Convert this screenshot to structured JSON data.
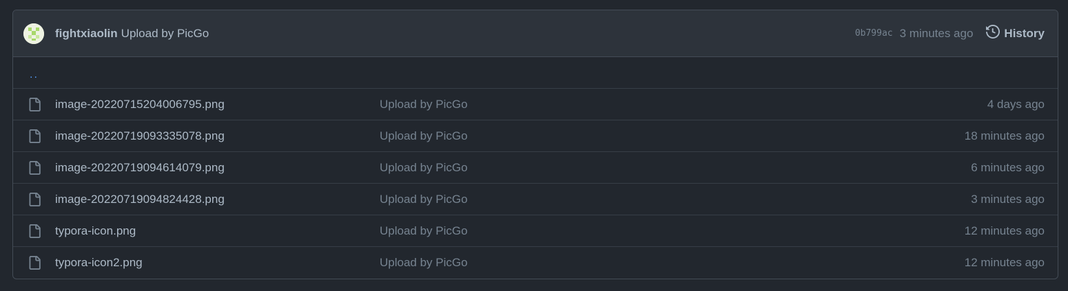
{
  "commit": {
    "author": "fightxiaolin",
    "message": "Upload by PicGo",
    "sha": "0b799ac",
    "time": "3 minutes ago",
    "history_label": "History"
  },
  "parent_dir": "..",
  "files": [
    {
      "name": "image-20220715204006795.png",
      "message": "Upload by PicGo",
      "age": "4 days ago",
      "icon": "file-icon"
    },
    {
      "name": "image-20220719093335078.png",
      "message": "Upload by PicGo",
      "age": "18 minutes ago",
      "icon": "file-icon"
    },
    {
      "name": "image-20220719094614079.png",
      "message": "Upload by PicGo",
      "age": "6 minutes ago",
      "icon": "file-icon"
    },
    {
      "name": "image-20220719094824428.png",
      "message": "Upload by PicGo",
      "age": "3 minutes ago",
      "icon": "file-icon"
    },
    {
      "name": "typora-icon.png",
      "message": "Upload by PicGo",
      "age": "12 minutes ago",
      "icon": "file-icon"
    },
    {
      "name": "typora-icon2.png",
      "message": "Upload by PicGo",
      "age": "12 minutes ago",
      "icon": "file-icon"
    }
  ],
  "colors": {
    "background": "#22272e",
    "header": "#2d333b",
    "border": "#444c56",
    "link": "#539bf5",
    "text": "#adbac7",
    "muted": "#768390"
  }
}
